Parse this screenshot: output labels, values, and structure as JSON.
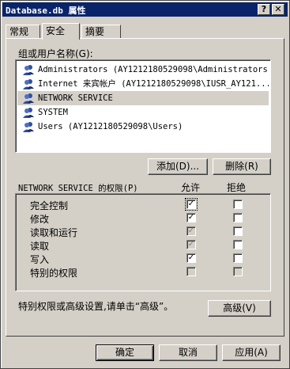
{
  "window": {
    "title": "Database.db 属性",
    "help_button": "?",
    "close_button": "✕"
  },
  "tabs": [
    {
      "label": "常规",
      "active": false
    },
    {
      "label": "安全",
      "active": true
    },
    {
      "label": "摘要",
      "active": false
    }
  ],
  "groups": {
    "label": "组或用户名称(G):",
    "items": [
      {
        "name": "Administrators (AY1212180529098\\Administrators)",
        "selected": false
      },
      {
        "name": "Internet 来宾帐户 (AY1212180529098\\IUSR_AY121...",
        "selected": false
      },
      {
        "name": "NETWORK SERVICE",
        "selected": true
      },
      {
        "name": "SYSTEM",
        "selected": false
      },
      {
        "name": "Users (AY1212180529098\\Users)",
        "selected": false
      }
    ],
    "add_label": "添加(D)...",
    "remove_label": "删除(R)"
  },
  "permissions": {
    "label": "NETWORK SERVICE 的权限(P)",
    "allow_header": "允许",
    "deny_header": "拒绝",
    "rows": [
      {
        "name": "完全控制",
        "allow": "checked",
        "deny": "unchecked"
      },
      {
        "name": "修改",
        "allow": "checked",
        "deny": "unchecked"
      },
      {
        "name": "读取和运行",
        "allow": "checked-disabled",
        "deny": "unchecked"
      },
      {
        "name": "读取",
        "allow": "checked-disabled",
        "deny": "unchecked"
      },
      {
        "name": "写入",
        "allow": "checked",
        "deny": "unchecked"
      },
      {
        "name": "特别的权限",
        "allow": "unchecked-disabled",
        "deny": "unchecked-disabled"
      }
    ]
  },
  "advanced": {
    "hint": "特别权限或高级设置,请单击“高级”。",
    "button_label": "高级(V)"
  },
  "footer": {
    "ok_label": "确定",
    "cancel_label": "取消",
    "apply_label": "应用(A)"
  },
  "icons": {
    "user": "user-group-icon",
    "check": "✓"
  }
}
